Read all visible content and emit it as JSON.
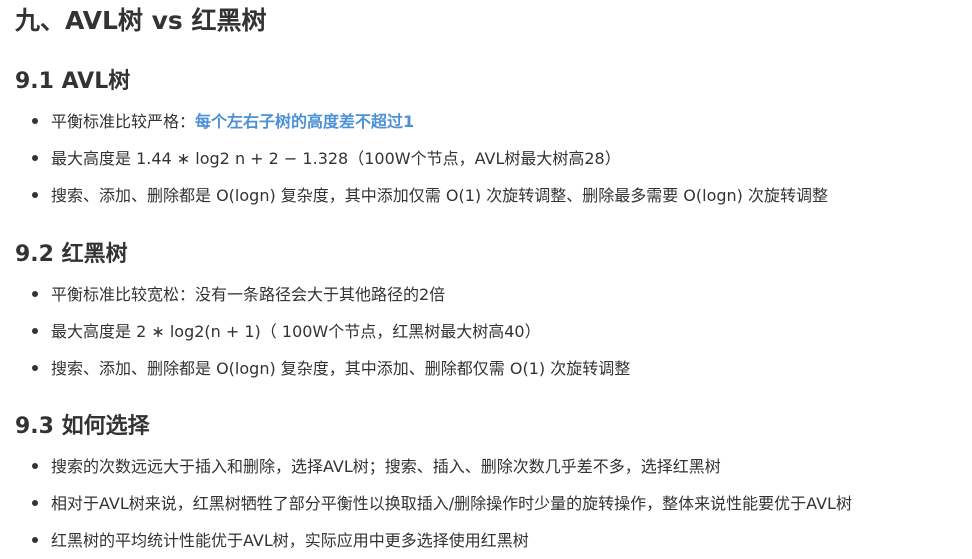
{
  "title": "九、AVL树 vs 红黑树",
  "sections": [
    {
      "heading": "9.1 AVL树",
      "items": [
        {
          "text": "平衡标准比较严格：",
          "highlight": "每个左右子树的高度差不超过1"
        },
        {
          "text": "最大高度是 1.44 ∗ log2 n + 2 − 1.328（100W个节点，AVL树最大树高28）"
        },
        {
          "text": "搜索、添加、删除都是 O(logn) 复杂度，其中添加仅需 O(1) 次旋转调整、删除最多需要 O(logn) 次旋转调整"
        }
      ]
    },
    {
      "heading": "9.2 红黑树",
      "items": [
        {
          "text": "平衡标准比较宽松：没有一条路径会大于其他路径的2倍"
        },
        {
          "text": "最大高度是 2 ∗ log2(n + 1)（ 100W个节点，红黑树最大树高40）"
        },
        {
          "text": "搜索、添加、删除都是 O(logn) 复杂度，其中添加、删除都仅需 O(1) 次旋转调整"
        }
      ]
    },
    {
      "heading": "9.3 如何选择",
      "items": [
        {
          "text": "搜索的次数远远大于插入和删除，选择AVL树；搜索、插入、删除次数几乎差不多，选择红黑树"
        },
        {
          "text": "相对于AVL树来说，红黑树牺牲了部分平衡性以换取插入/删除操作时少量的旋转操作，整体来说性能要优于AVL树"
        },
        {
          "text": "红黑树的平均统计性能优于AVL树，实际应用中更多选择使用红黑树"
        }
      ]
    }
  ]
}
